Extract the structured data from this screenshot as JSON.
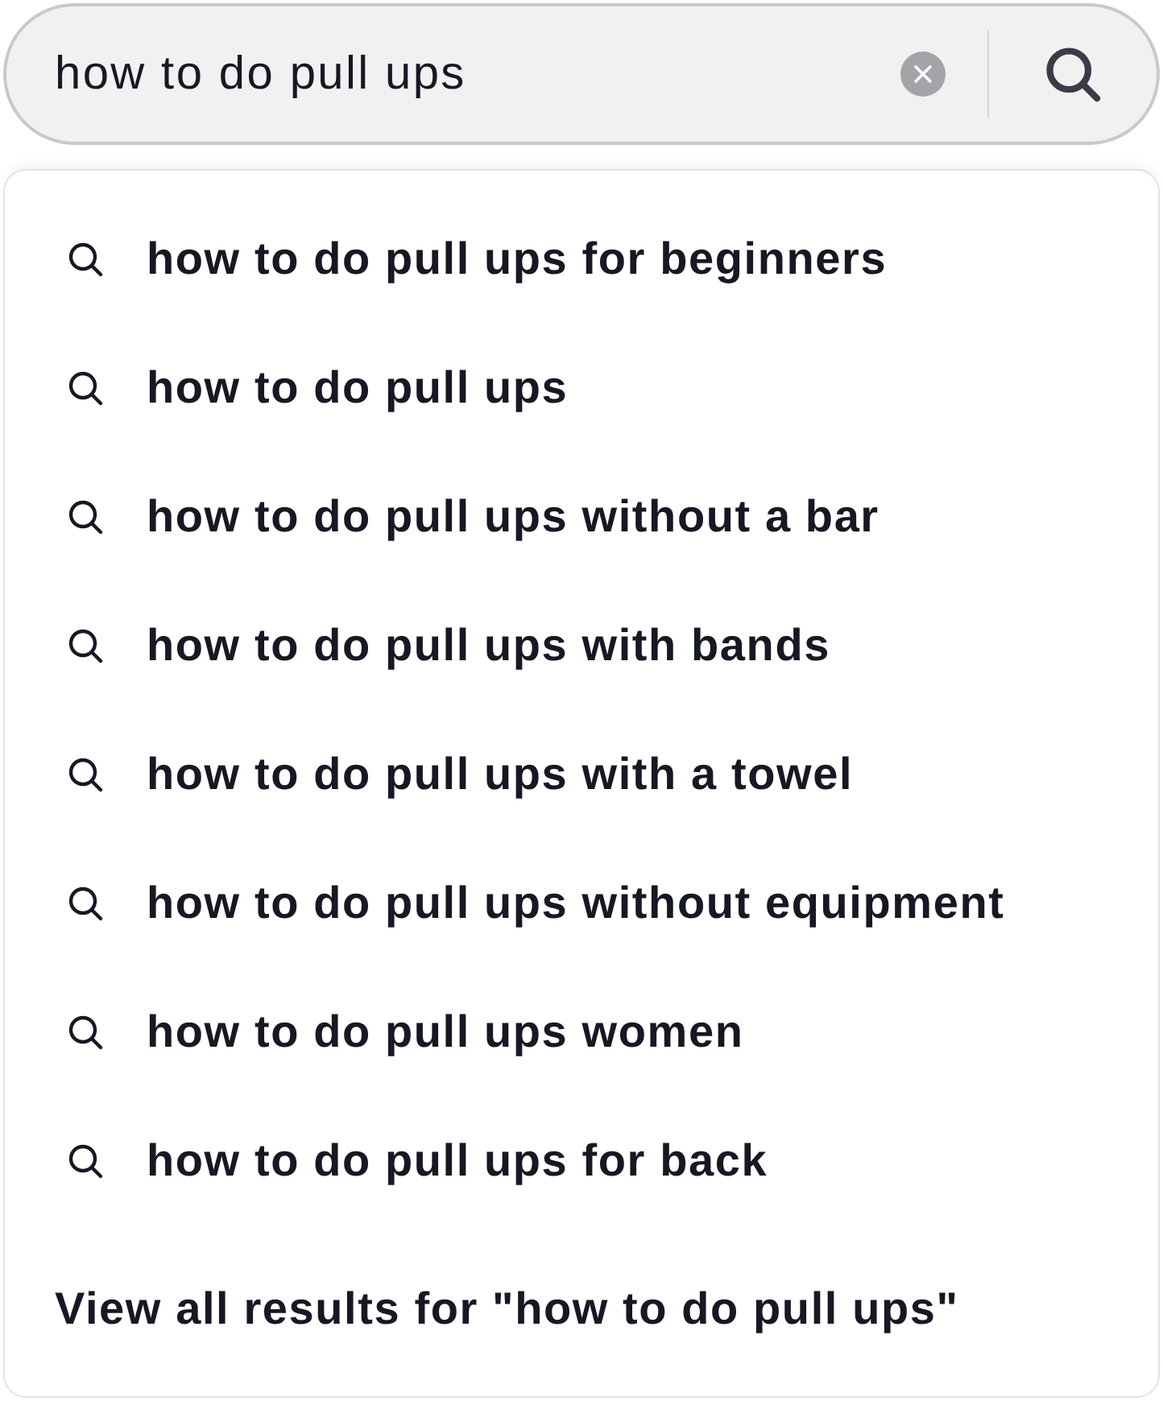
{
  "search": {
    "value": "how to do pull ups"
  },
  "suggestions": [
    {
      "text": "how to do pull ups for beginners"
    },
    {
      "text": "how to do pull ups"
    },
    {
      "text": "how to do pull ups without a bar"
    },
    {
      "text": "how to do pull ups with bands"
    },
    {
      "text": "how to do pull ups with a towel"
    },
    {
      "text": "how to do pull ups without equipment"
    },
    {
      "text": "how to do pull ups women"
    },
    {
      "text": "how to do pull ups for back"
    }
  ],
  "view_all": "View all results for \"how to do pull ups\""
}
